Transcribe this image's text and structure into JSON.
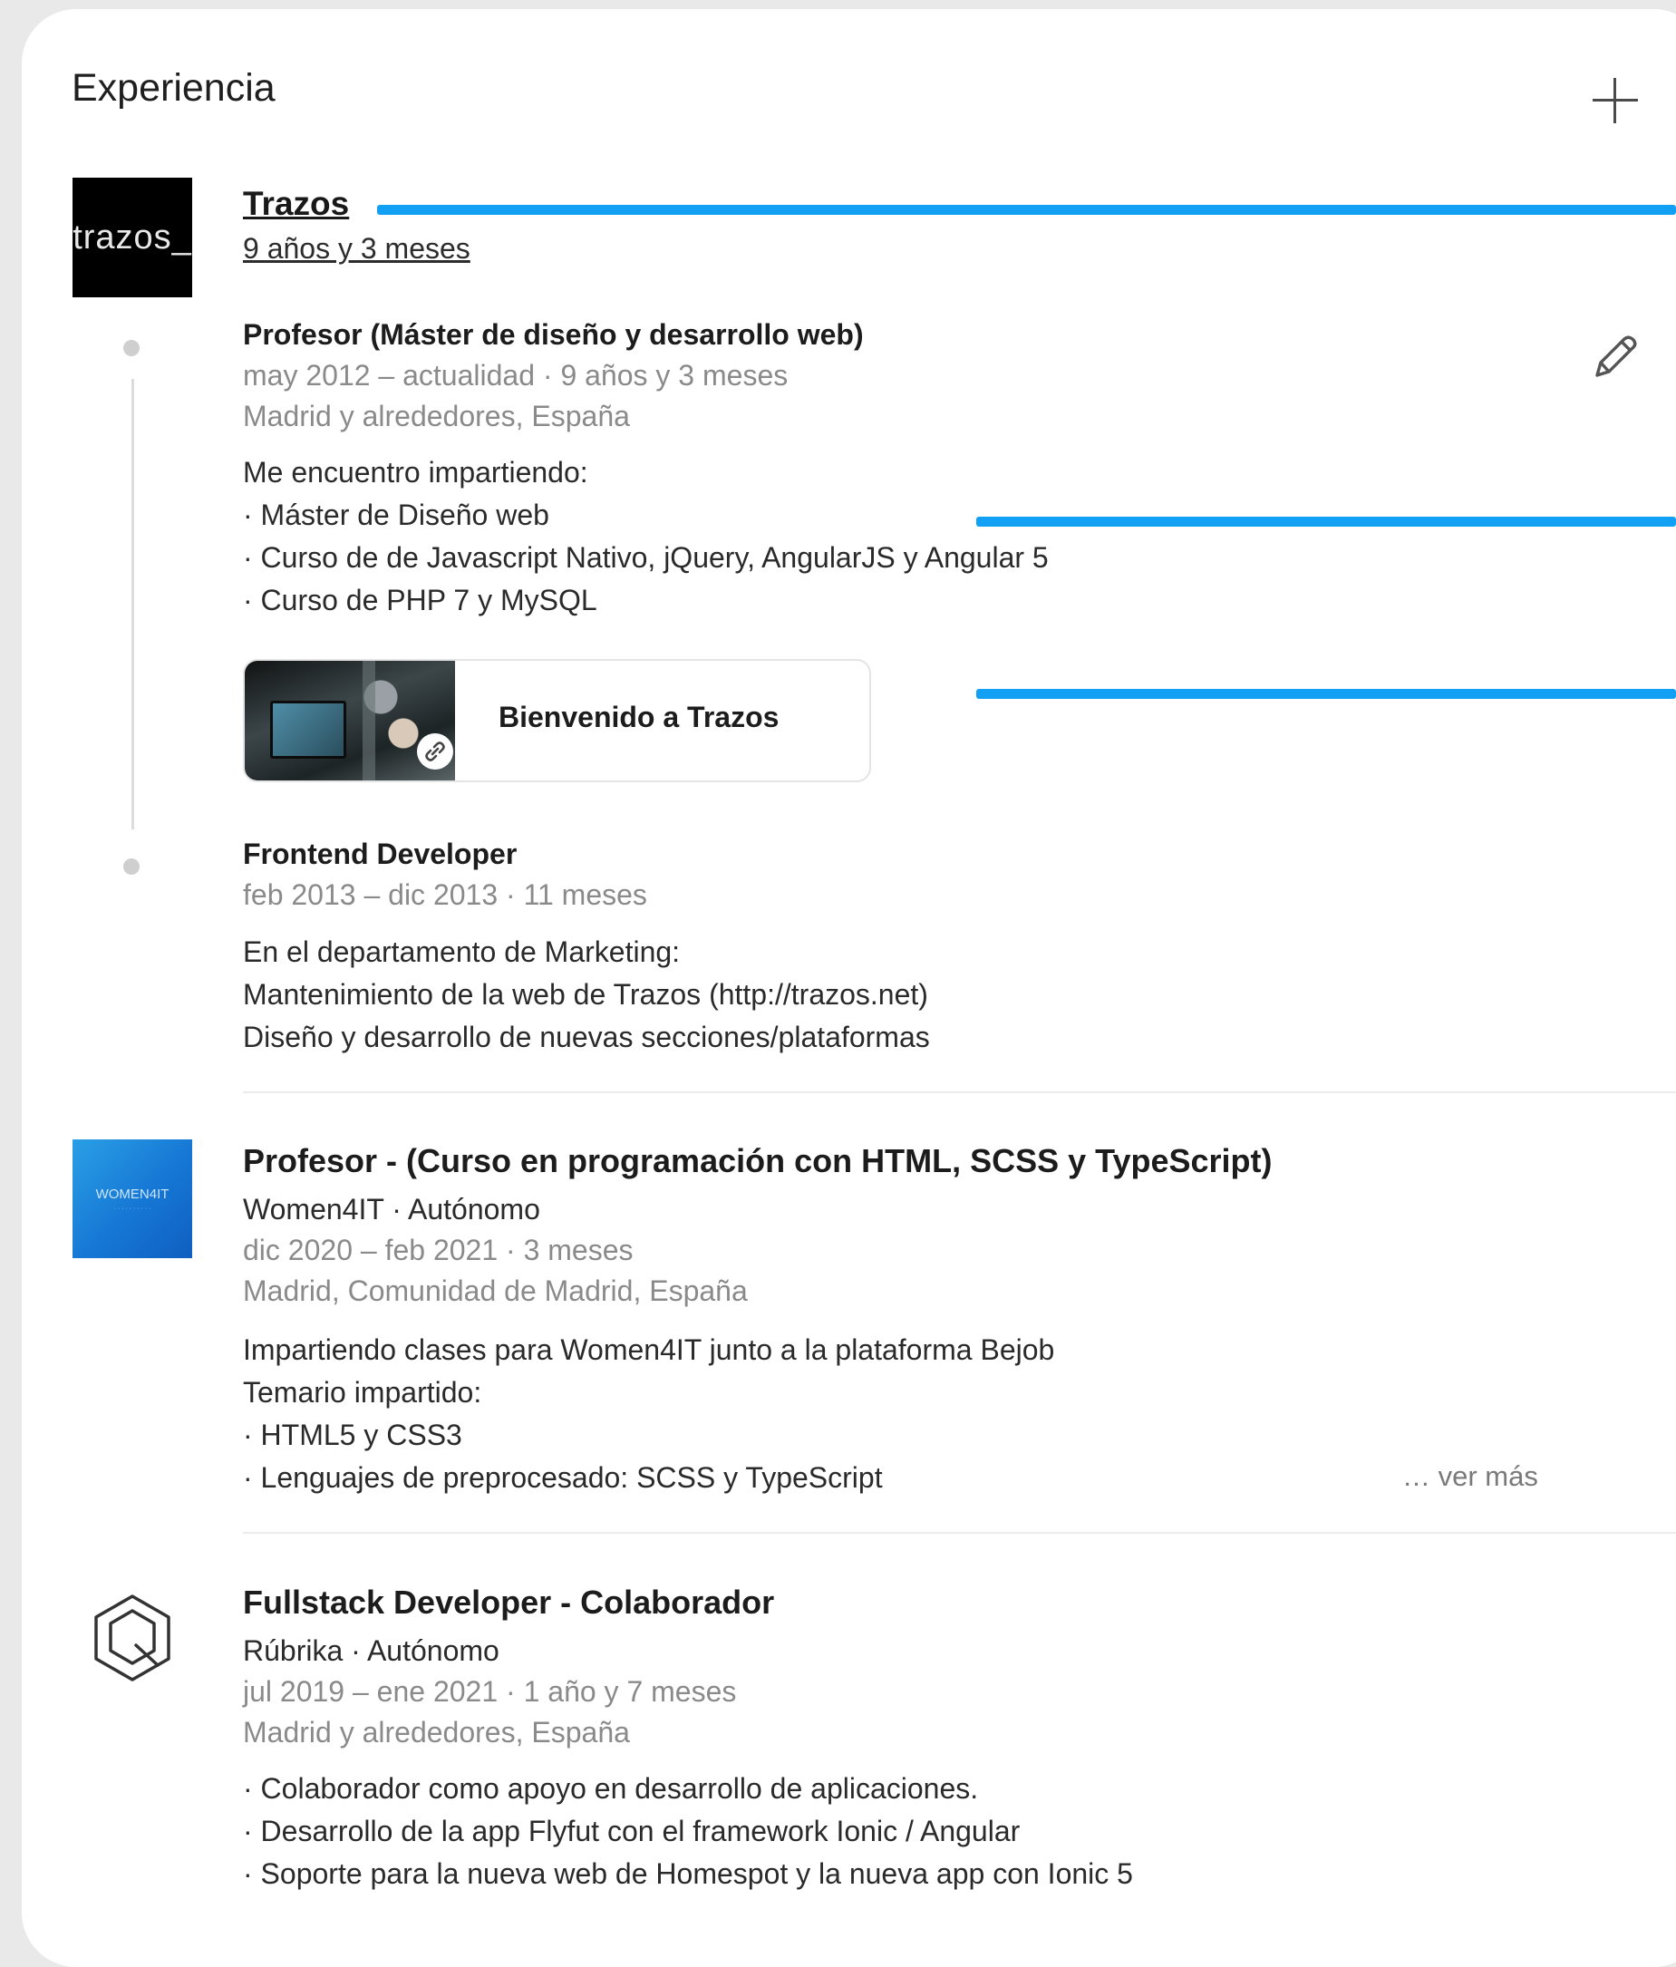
{
  "section": {
    "title": "Experiencia",
    "add_icon": "plus-icon"
  },
  "trazos": {
    "company": "Trazos",
    "logo_text": "trazos_",
    "total_duration": "9 años y 3 meses",
    "roles": [
      {
        "title": "Profesor (Máster de diseño y desarrollo web)",
        "dates": "may 2012 – actualidad · 9 años y 3 meses",
        "location": "Madrid y alrededores, España",
        "description": [
          "Me encuentro impartiendo:",
          "· Máster de Diseño web",
          "· Curso de de Javascript Nativo, jQuery, AngularJS y Angular 5",
          "· Curso de PHP 7 y MySQL"
        ],
        "media": {
          "title": "Bienvenido a Trazos",
          "badge_icon": "link-icon"
        }
      },
      {
        "title": "Frontend Developer",
        "dates": "feb 2013 – dic 2013 · 11 meses",
        "description": [
          "En el departamento de Marketing:",
          "Mantenimiento de la web de Trazos (http://trazos.net)",
          "Diseño y desarrollo de nuevas secciones/plataformas"
        ]
      }
    ]
  },
  "women4it": {
    "logo_text": "WOMEN4IT",
    "title": "Profesor - (Curso en programación con HTML, SCSS y TypeScript)",
    "company_line": "Women4IT · Autónomo",
    "dates": "dic 2020 – feb 2021 · 3 meses",
    "location": "Madrid, Comunidad de Madrid, España",
    "description": [
      "Impartiendo clases para Women4IT junto a la plataforma Bejob",
      "Temario impartido:",
      "· HTML5 y CSS3",
      "· Lenguajes de preprocesado: SCSS y TypeScript"
    ],
    "see_more": "… ver más"
  },
  "rubrika": {
    "title": "Fullstack Developer - Colaborador",
    "company_line": "Rúbrika · Autónomo",
    "dates": "jul 2019 – ene 2021 · 1 año y 7 meses",
    "location": "Madrid y alrededores, España",
    "description": [
      "· Colaborador como apoyo en desarrollo de aplicaciones.",
      "· Desarrollo de la app Flyfut con el framework Ionic / Angular",
      "· Soporte para la nueva web de Homespot y la nueva app con Ionic 5"
    ]
  },
  "colors": {
    "highlight_bar": "#12a0f5",
    "muted_text": "#8a8a8a"
  }
}
